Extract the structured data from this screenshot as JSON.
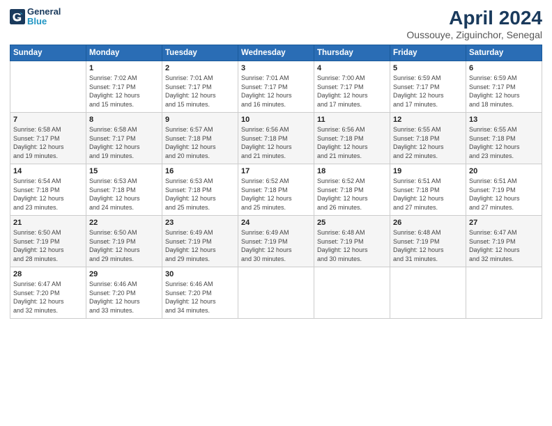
{
  "logo": {
    "line1": "General",
    "line2": "Blue"
  },
  "title": "April 2024",
  "subtitle": "Oussouye, Ziguinchor, Senegal",
  "days_header": [
    "Sunday",
    "Monday",
    "Tuesday",
    "Wednesday",
    "Thursday",
    "Friday",
    "Saturday"
  ],
  "weeks": [
    [
      {
        "num": "",
        "info": ""
      },
      {
        "num": "1",
        "info": "Sunrise: 7:02 AM\nSunset: 7:17 PM\nDaylight: 12 hours\nand 15 minutes."
      },
      {
        "num": "2",
        "info": "Sunrise: 7:01 AM\nSunset: 7:17 PM\nDaylight: 12 hours\nand 15 minutes."
      },
      {
        "num": "3",
        "info": "Sunrise: 7:01 AM\nSunset: 7:17 PM\nDaylight: 12 hours\nand 16 minutes."
      },
      {
        "num": "4",
        "info": "Sunrise: 7:00 AM\nSunset: 7:17 PM\nDaylight: 12 hours\nand 17 minutes."
      },
      {
        "num": "5",
        "info": "Sunrise: 6:59 AM\nSunset: 7:17 PM\nDaylight: 12 hours\nand 17 minutes."
      },
      {
        "num": "6",
        "info": "Sunrise: 6:59 AM\nSunset: 7:17 PM\nDaylight: 12 hours\nand 18 minutes."
      }
    ],
    [
      {
        "num": "7",
        "info": "Sunrise: 6:58 AM\nSunset: 7:17 PM\nDaylight: 12 hours\nand 19 minutes."
      },
      {
        "num": "8",
        "info": "Sunrise: 6:58 AM\nSunset: 7:17 PM\nDaylight: 12 hours\nand 19 minutes."
      },
      {
        "num": "9",
        "info": "Sunrise: 6:57 AM\nSunset: 7:18 PM\nDaylight: 12 hours\nand 20 minutes."
      },
      {
        "num": "10",
        "info": "Sunrise: 6:56 AM\nSunset: 7:18 PM\nDaylight: 12 hours\nand 21 minutes."
      },
      {
        "num": "11",
        "info": "Sunrise: 6:56 AM\nSunset: 7:18 PM\nDaylight: 12 hours\nand 21 minutes."
      },
      {
        "num": "12",
        "info": "Sunrise: 6:55 AM\nSunset: 7:18 PM\nDaylight: 12 hours\nand 22 minutes."
      },
      {
        "num": "13",
        "info": "Sunrise: 6:55 AM\nSunset: 7:18 PM\nDaylight: 12 hours\nand 23 minutes."
      }
    ],
    [
      {
        "num": "14",
        "info": "Sunrise: 6:54 AM\nSunset: 7:18 PM\nDaylight: 12 hours\nand 23 minutes."
      },
      {
        "num": "15",
        "info": "Sunrise: 6:53 AM\nSunset: 7:18 PM\nDaylight: 12 hours\nand 24 minutes."
      },
      {
        "num": "16",
        "info": "Sunrise: 6:53 AM\nSunset: 7:18 PM\nDaylight: 12 hours\nand 25 minutes."
      },
      {
        "num": "17",
        "info": "Sunrise: 6:52 AM\nSunset: 7:18 PM\nDaylight: 12 hours\nand 25 minutes."
      },
      {
        "num": "18",
        "info": "Sunrise: 6:52 AM\nSunset: 7:18 PM\nDaylight: 12 hours\nand 26 minutes."
      },
      {
        "num": "19",
        "info": "Sunrise: 6:51 AM\nSunset: 7:18 PM\nDaylight: 12 hours\nand 27 minutes."
      },
      {
        "num": "20",
        "info": "Sunrise: 6:51 AM\nSunset: 7:19 PM\nDaylight: 12 hours\nand 27 minutes."
      }
    ],
    [
      {
        "num": "21",
        "info": "Sunrise: 6:50 AM\nSunset: 7:19 PM\nDaylight: 12 hours\nand 28 minutes."
      },
      {
        "num": "22",
        "info": "Sunrise: 6:50 AM\nSunset: 7:19 PM\nDaylight: 12 hours\nand 29 minutes."
      },
      {
        "num": "23",
        "info": "Sunrise: 6:49 AM\nSunset: 7:19 PM\nDaylight: 12 hours\nand 29 minutes."
      },
      {
        "num": "24",
        "info": "Sunrise: 6:49 AM\nSunset: 7:19 PM\nDaylight: 12 hours\nand 30 minutes."
      },
      {
        "num": "25",
        "info": "Sunrise: 6:48 AM\nSunset: 7:19 PM\nDaylight: 12 hours\nand 30 minutes."
      },
      {
        "num": "26",
        "info": "Sunrise: 6:48 AM\nSunset: 7:19 PM\nDaylight: 12 hours\nand 31 minutes."
      },
      {
        "num": "27",
        "info": "Sunrise: 6:47 AM\nSunset: 7:19 PM\nDaylight: 12 hours\nand 32 minutes."
      }
    ],
    [
      {
        "num": "28",
        "info": "Sunrise: 6:47 AM\nSunset: 7:20 PM\nDaylight: 12 hours\nand 32 minutes."
      },
      {
        "num": "29",
        "info": "Sunrise: 6:46 AM\nSunset: 7:20 PM\nDaylight: 12 hours\nand 33 minutes."
      },
      {
        "num": "30",
        "info": "Sunrise: 6:46 AM\nSunset: 7:20 PM\nDaylight: 12 hours\nand 34 minutes."
      },
      {
        "num": "",
        "info": ""
      },
      {
        "num": "",
        "info": ""
      },
      {
        "num": "",
        "info": ""
      },
      {
        "num": "",
        "info": ""
      }
    ]
  ]
}
